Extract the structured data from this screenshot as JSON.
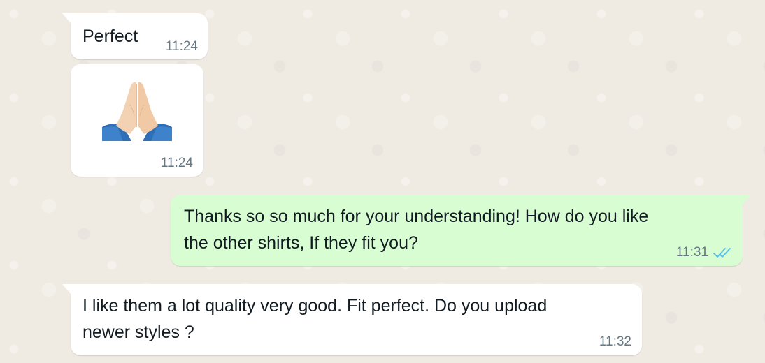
{
  "messages": [
    {
      "direction": "incoming",
      "text": "Perfect",
      "time": "11:24"
    },
    {
      "direction": "incoming",
      "emoji": "folded-hands",
      "time": "11:24"
    },
    {
      "direction": "outgoing",
      "line1": "Thanks so so much for your understanding! How do you like",
      "line2": "the other shirts, If they fit you?",
      "time": "11:31",
      "status_icon": "double-check-read-icon",
      "status_color": "#53bdeb"
    },
    {
      "direction": "incoming",
      "line1": "I like them a lot quality very good. Fit perfect. Do you upload",
      "line2": "newer styles ?",
      "time": "11:32"
    }
  ],
  "colors": {
    "chat_background": "#efeae2",
    "incoming_bubble": "#ffffff",
    "outgoing_bubble": "#d9fdd3",
    "timestamp": "#667781"
  }
}
